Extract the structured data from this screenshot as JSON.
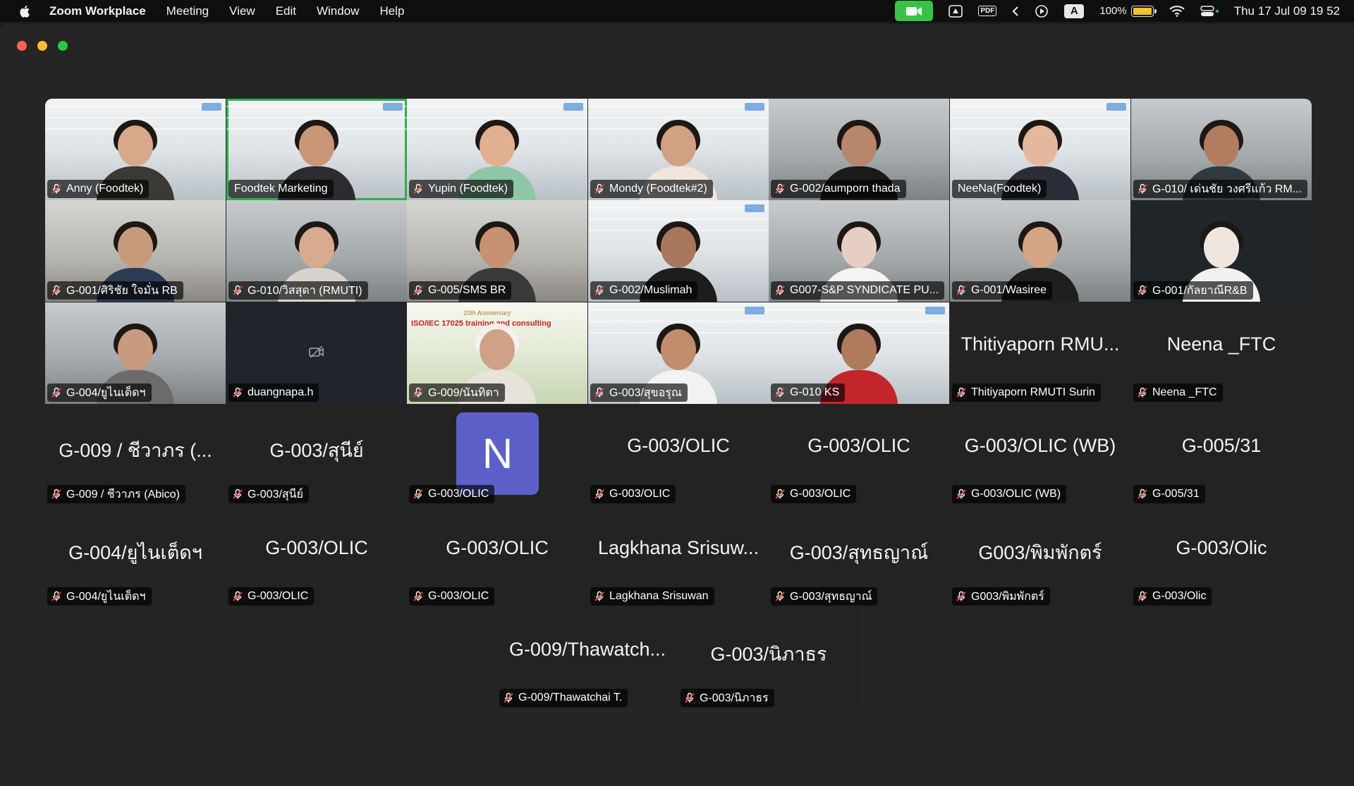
{
  "menubar": {
    "app_name": "Zoom Workplace",
    "menus": [
      "Meeting",
      "View",
      "Edit",
      "Window",
      "Help"
    ],
    "battery_percent": "100%",
    "battery_level": 1.0,
    "pdf_label": "PDF",
    "input_source": "A",
    "clock": "Thu 17 Jul  09 19 52"
  },
  "colors": {
    "active_speaker_border": "#2eae4a",
    "avatar_bg": "#5b5fc7",
    "mute_icon": "#e0453f",
    "zoom_indicator": "#37c24a"
  },
  "tiles": [
    {
      "name": "Anny (Foodtek)",
      "big": "",
      "muted": true
    },
    {
      "name": "Foodtek Marketing",
      "big": "",
      "muted": false,
      "active": true
    },
    {
      "name": "Yupin (Foodtek)",
      "big": "",
      "muted": true
    },
    {
      "name": "Mondy (Foodtek#2)",
      "big": "",
      "muted": true
    },
    {
      "name": "G-002/aumporn thada",
      "big": "",
      "muted": true
    },
    {
      "name": "NeeNa(Foodtek)",
      "big": "",
      "muted": false
    },
    {
      "name": "G-010/ เด่นชัย วงศรีแก้ว RM...",
      "big": "",
      "muted": true
    },
    {
      "name": "G-001/ศิริชัย ใจมั่น RB",
      "big": "",
      "muted": true
    },
    {
      "name": "G-010/วิสสุดา (RMUTI)",
      "big": "",
      "muted": true
    },
    {
      "name": "G-005/SMS BR",
      "big": "",
      "muted": true
    },
    {
      "name": "G-002/Muslimah",
      "big": "",
      "muted": true
    },
    {
      "name": "G007-S&P SYNDICATE PU...",
      "big": "",
      "muted": true
    },
    {
      "name": "G-001/Wasiree",
      "big": "",
      "muted": true
    },
    {
      "name": "G-001/กัลยาณีR&B",
      "big": "",
      "muted": true
    },
    {
      "name": "G-004/ยูไนเต็ดฯ",
      "big": "",
      "muted": true
    },
    {
      "name": "duangnapa.h",
      "big": "",
      "muted": true,
      "camera_off": true
    },
    {
      "name": "G-009/นันทิตา",
      "big": "",
      "muted": true,
      "banner_title": "ISO/IEC 17025 training and consulting",
      "banner_sub": "10th Anniversary"
    },
    {
      "name": "G-003/สุขอรุณ",
      "big": "",
      "muted": true
    },
    {
      "name": "G-010 KS",
      "big": "",
      "muted": true
    },
    {
      "name": "Thitiyaporn RMUTI Surin",
      "big": "Thitiyaporn RMU...",
      "muted": true
    },
    {
      "name": "Neena _FTC",
      "big": "Neena _FTC",
      "muted": true
    },
    {
      "name": "G-009 / ชีวาภร (Abico)",
      "big": "G-009 / ชีวาภร (...",
      "muted": true
    },
    {
      "name": "G-003/สุนีย์",
      "big": "G-003/สุนีย์",
      "muted": true
    },
    {
      "name": "G-003/OLIC",
      "big": "",
      "muted": true,
      "avatar": "N"
    },
    {
      "name": "G-003/OLIC",
      "big": "G-003/OLIC",
      "muted": true
    },
    {
      "name": "G-003/OLIC",
      "big": "G-003/OLIC",
      "muted": true
    },
    {
      "name": "G-003/OLIC (WB)",
      "big": "G-003/OLIC (WB)",
      "muted": true
    },
    {
      "name": "G-005/31",
      "big": "G-005/31",
      "muted": true
    },
    {
      "name": "G-004/ยูไนเต็ดฯ",
      "big": "G-004/ยูไนเต็ดฯ",
      "muted": true
    },
    {
      "name": "G-003/OLIC",
      "big": "G-003/OLIC",
      "muted": true
    },
    {
      "name": "G-003/OLIC",
      "big": "G-003/OLIC",
      "muted": true
    },
    {
      "name": "Lagkhana Srisuwan",
      "big": "Lagkhana Srisuw...",
      "muted": true
    },
    {
      "name": "G-003/สุทธญาณ์",
      "big": "G-003/สุทธญาณ์",
      "muted": true
    },
    {
      "name": "G003/พิมพักตร์",
      "big": "G003/พิมพักตร์",
      "muted": true
    },
    {
      "name": "G-003/Olic",
      "big": "G-003/Olic",
      "muted": true
    }
  ],
  "extra_tiles": [
    {
      "name": "G-009/Thawatchai T.",
      "big": "G-009/Thawatch...",
      "muted": true
    },
    {
      "name": "G-003/นิภาธร",
      "big": "G-003/นิภาธร",
      "muted": true
    }
  ]
}
